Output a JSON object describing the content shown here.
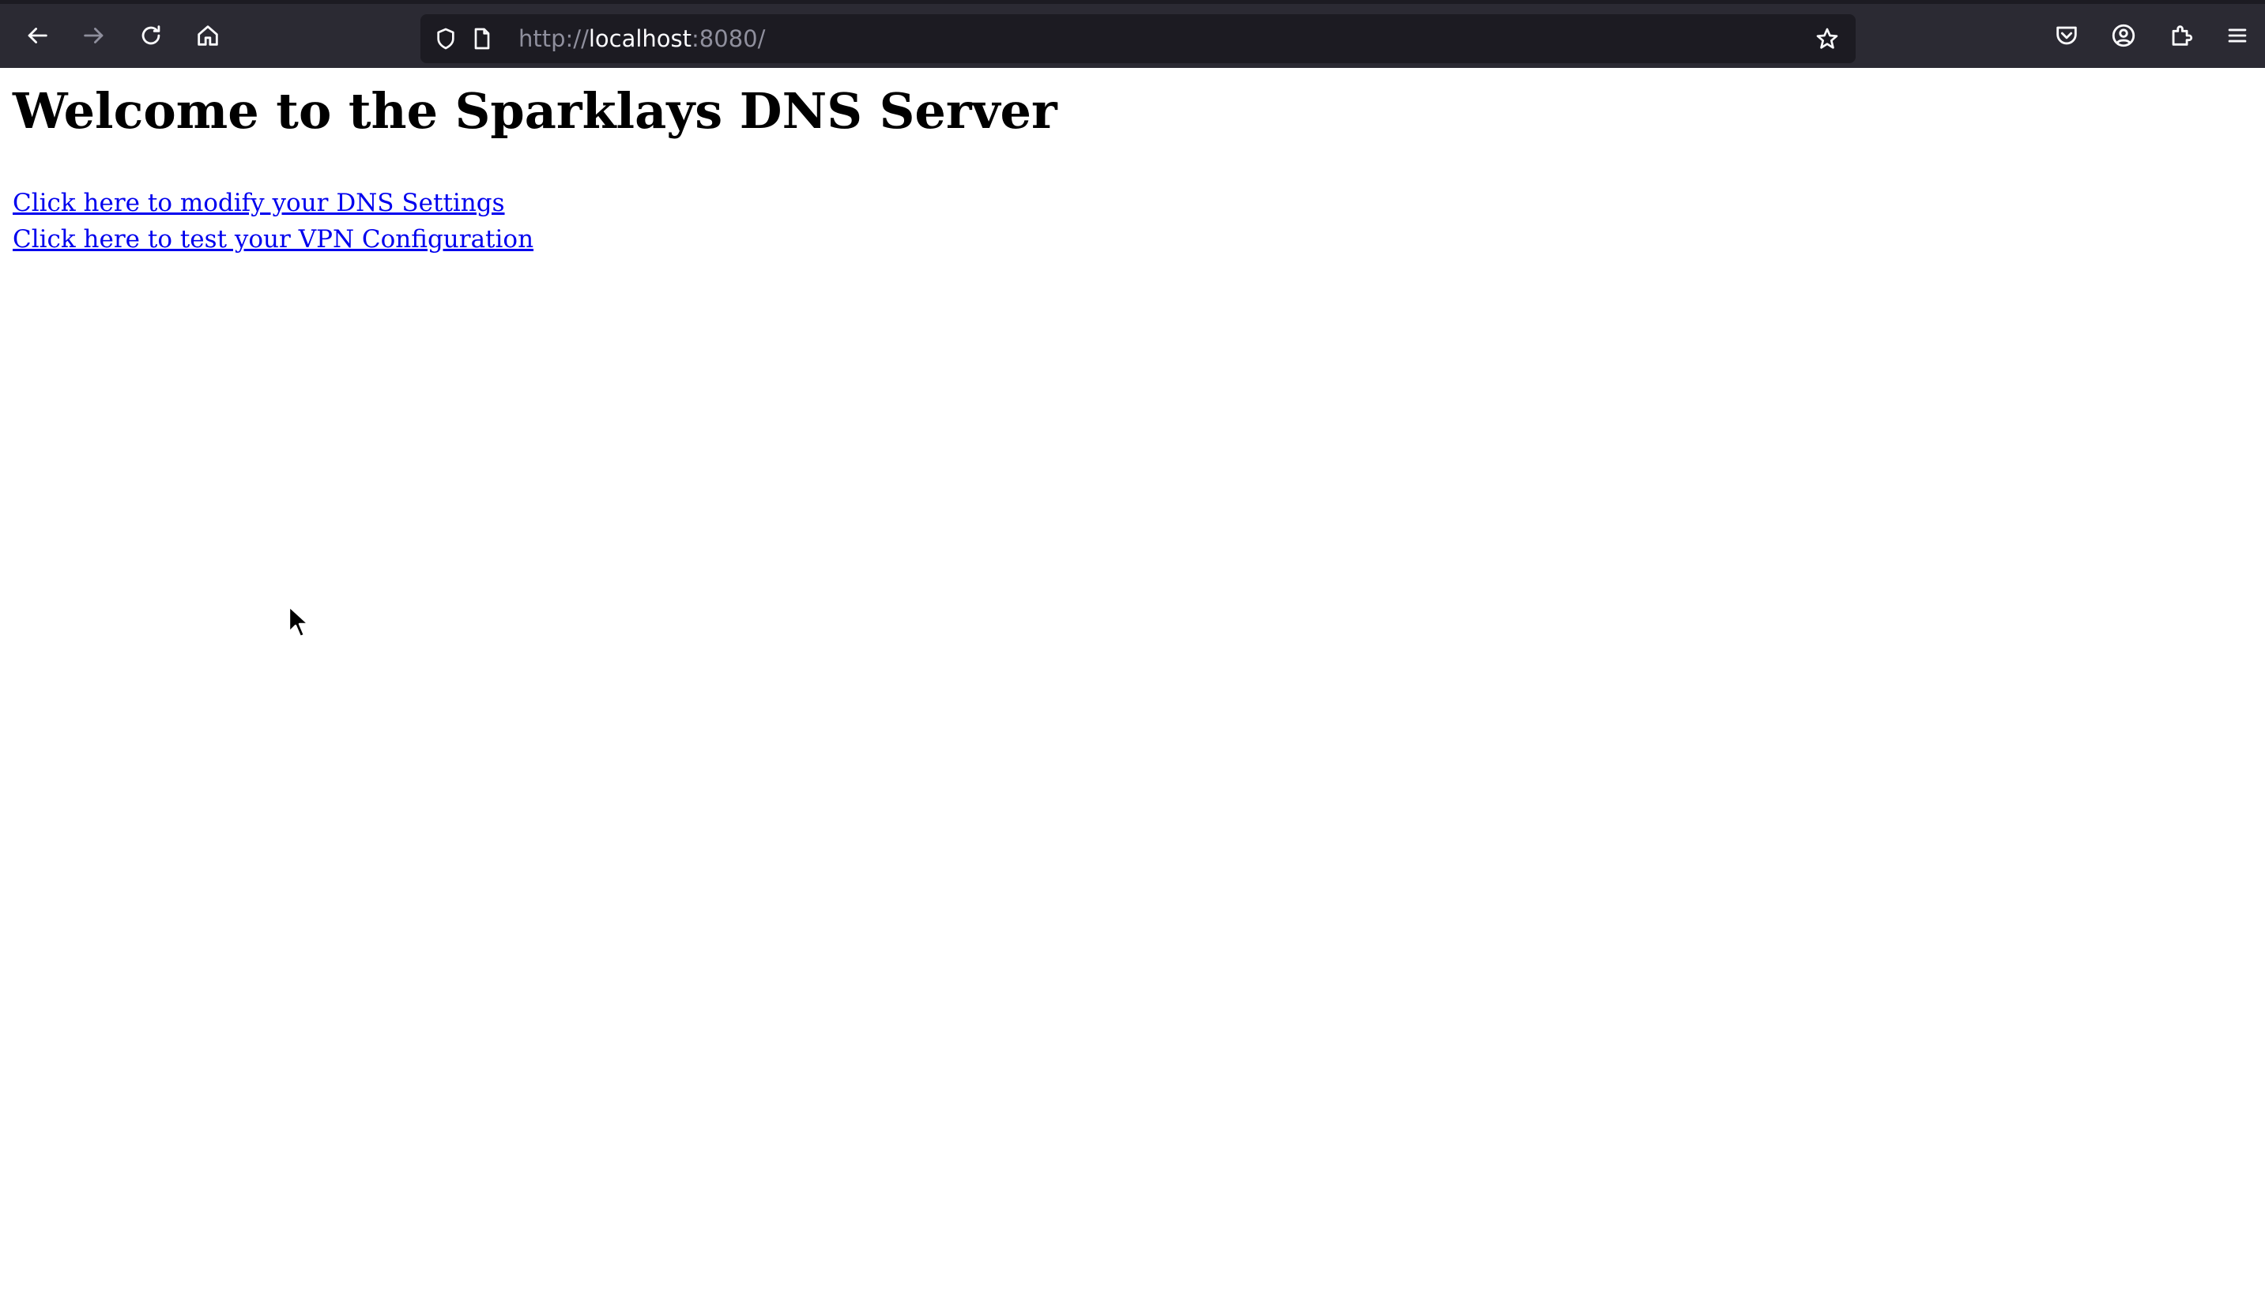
{
  "browser": {
    "url_scheme": "http://",
    "url_host": "localhost",
    "url_rest": ":8080/",
    "icons": {
      "back": "back-arrow-icon",
      "forward": "forward-arrow-icon",
      "reload": "reload-icon",
      "home": "home-icon",
      "tracking_protection": "shield-icon",
      "page_info": "page-icon",
      "bookmark": "star-icon",
      "pocket": "pocket-icon",
      "account": "account-icon",
      "extensions": "puzzle-icon",
      "menu": "hamburger-menu-icon"
    },
    "forward_enabled": false,
    "toolbar_color": "#2b2a33",
    "urlbar_color": "#1c1b22"
  },
  "page": {
    "title": "Welcome to the Sparklays DNS Server",
    "links": [
      {
        "label": "Click here to modify your DNS Settings"
      },
      {
        "label": "Click here to test your VPN Configuration"
      }
    ],
    "link_color": "#0000ee",
    "background": "#ffffff"
  }
}
